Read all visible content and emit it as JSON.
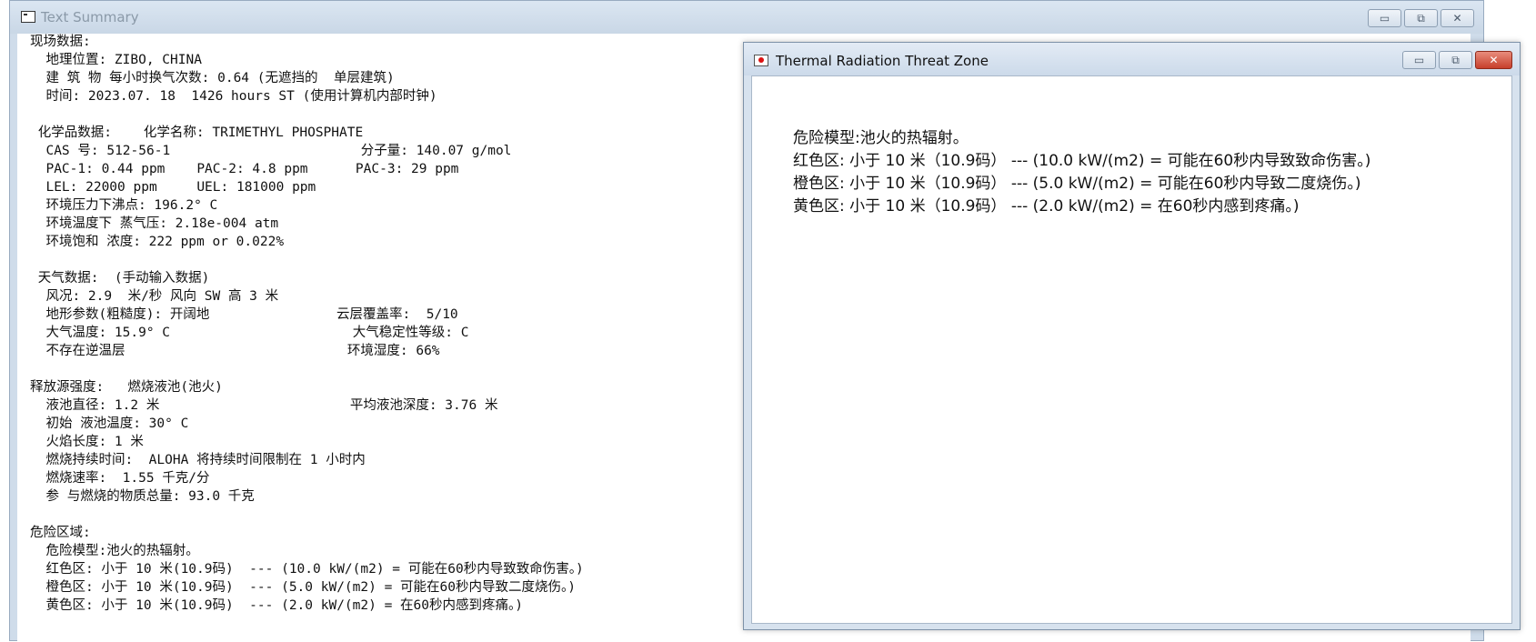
{
  "main_window": {
    "title": "Text Summary",
    "controls": {
      "minimize": "▭",
      "maximize": "⧉",
      "close": "✕"
    },
    "lines": [
      "现场数据:",
      "  地理位置: ZIBO, CHINA",
      "  建 筑 物 每小时换气次数: 0.64 (无遮挡的  单层建筑)",
      "  时间: 2023.07. 18  1426 hours ST (使用计算机内部时钟)",
      "",
      " 化学品数据:    化学名称: TRIMETHYL PHOSPHATE",
      "  CAS 号: 512-56-1                        分子量: 140.07 g/mol",
      "  PAC-1: 0.44 ppm    PAC-2: 4.8 ppm      PAC-3: 29 ppm",
      "  LEL: 22000 ppm     UEL: 181000 ppm",
      "  环境压力下沸点: 196.2° C",
      "  环境温度下 蒸气压: 2.18e-004 atm",
      "  环境饱和 浓度: 222 ppm or 0.022%",
      "",
      " 天气数据:  (手动输入数据)",
      "  风况: 2.9  米/秒 风向 SW 高 3 米",
      "  地形参数(粗糙度): 开阔地                云层覆盖率:  5/10",
      "  大气温度: 15.9° C                       大气稳定性等级: C",
      "  不存在逆温层                            环境湿度: 66%",
      "",
      "释放源强度:   燃烧液池(池火)",
      "  液池直径: 1.2 米                        平均液池深度: 3.76 米",
      "  初始 液池温度: 30° C",
      "  火焰长度: 1 米",
      "  燃烧持续时间:  ALOHA 将持续时间限制在 1 小时内",
      "  燃烧速率:  1.55 千克/分",
      "  参 与燃烧的物质总量: 93.0 千克",
      "",
      "危险区域:",
      "  危险模型:池火的热辐射。",
      "  红色区: 小于 10 米(10.9码)  --- (10.0 kW/(m2) = 可能在60秒内导致致命伤害。)",
      "  橙色区: 小于 10 米(10.9码)  --- (5.0 kW/(m2) = 可能在60秒内导致二度烧伤。)",
      "  黄色区: 小于 10 米(10.9码)  --- (2.0 kW/(m2) = 在60秒内感到疼痛。)"
    ]
  },
  "threat_window": {
    "title": "Thermal Radiation Threat Zone",
    "controls": {
      "minimize": "▭",
      "maximize": "⧉",
      "close": "✕"
    },
    "lines": [
      "危险模型:池火的热辐射。",
      "红色区: 小于 10 米（10.9码） --- (10.0 kW/(m2) = 可能在60秒内导致致命伤害。)",
      "橙色区: 小于 10 米（10.9码） --- (5.0 kW/(m2) = 可能在60秒内导致二度烧伤。)",
      "黄色区: 小于 10 米（10.9码） --- (2.0 kW/(m2) = 在60秒内感到疼痛。)"
    ]
  }
}
